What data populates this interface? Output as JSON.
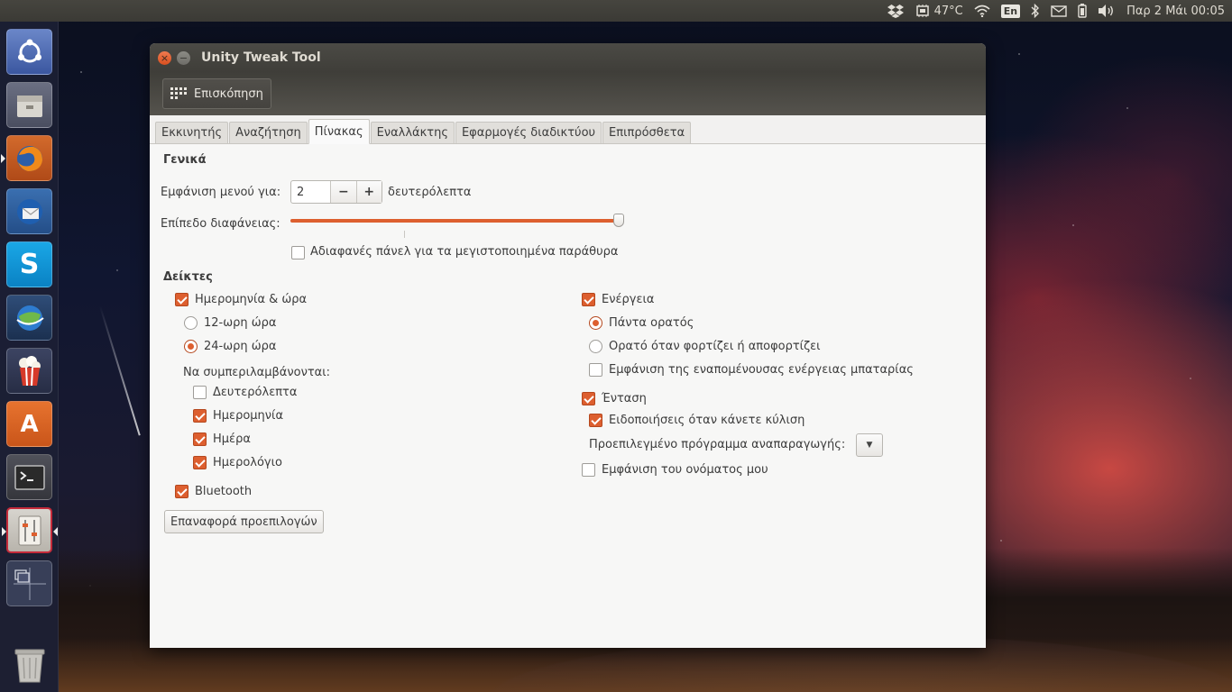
{
  "desktop": {
    "top_panel": {
      "temperature": "47°C",
      "keyboard_layout": "En",
      "clock": "Παρ  2 Μάι 00:05",
      "icons": [
        "dropbox-icon",
        "cpu-icon",
        "wifi-icon",
        "bluetooth-icon",
        "mail-icon",
        "battery-icon",
        "volume-icon"
      ]
    },
    "launcher": {
      "items": [
        "dash-home-icon",
        "files-icon",
        "firefox-icon",
        "thunderbird-icon",
        "skype-icon",
        "google-earth-icon",
        "popcorn-time-icon",
        "software-center-icon",
        "terminal-icon",
        "unity-tweak-tool-icon",
        "workspace-switcher-icon",
        "trash-icon"
      ]
    }
  },
  "window": {
    "title": "Unity Tweak Tool",
    "toolbar": {
      "overview_label": "Επισκόπηση"
    },
    "tabs": [
      "Εκκινητής",
      "Αναζήτηση",
      "Πίνακας",
      "Εναλλάκτης",
      "Εφαρμογές διαδικτύου",
      "Επιπρόσθετα"
    ],
    "active_tab": "Πίνακας",
    "general": {
      "title": "Γενικά",
      "menu_visible_label": "Εμφάνιση μενού για:",
      "menu_visible_value": "2",
      "menu_visible_unit": "δευτερόλεπτα",
      "minus": "−",
      "plus": "+",
      "transparency_label": "Επίπεδο διαφάνειας:",
      "transparency_level": 1.0,
      "opaque_label": "Αδιαφανές πάνελ για τα μεγιστοποιημένα παράθυρα",
      "opaque_checked": false
    },
    "indicators": {
      "title": "Δείκτες",
      "datetime_label": "Ημερομηνία & ώρα",
      "datetime_checked": true,
      "hour12_label": "12-ωρη ώρα",
      "hour24_label": "24-ωρη ώρα",
      "selected_clock": "24-ωρη ώρα",
      "include_label": "Να συμπεριλαμβάνονται:",
      "seconds_label": "Δευτερόλεπτα",
      "seconds_checked": false,
      "date_label": "Ημερομηνία",
      "date_checked": true,
      "weekday_label": "Ημέρα",
      "weekday_checked": true,
      "calendar_label": "Ημερολόγιο",
      "calendar_checked": true,
      "bluetooth_label": "Bluetooth",
      "bluetooth_checked": true,
      "reset_label": "Επαναφορά προεπιλογών",
      "power_label": "Ενέργεια",
      "power_checked": true,
      "always_visible_label": "Πάντα ορατός",
      "charging_visible_label": "Ορατό όταν φορτίζει ή αποφορτίζει",
      "selected_power_mode": "Πάντα ορατός",
      "battery_remaining_label": "Εμφάνιση της εναπομένουσας ενέργειας μπαταρίας",
      "battery_remaining_checked": false,
      "volume_label": "Ένταση",
      "volume_checked": true,
      "scroll_notify_label": "Ειδοποιήσεις όταν κάνετε κύλιση",
      "scroll_notify_checked": true,
      "default_player_label": "Προεπιλεγμένο πρόγραμμα αναπαραγωγής:",
      "show_name_label": "Εμφάνιση του ονόματος μου",
      "show_name_checked": false
    }
  },
  "colors": {
    "accent": "#dd5f2f",
    "panel": "#3f3e39",
    "window_bg": "#f7f7f6"
  }
}
